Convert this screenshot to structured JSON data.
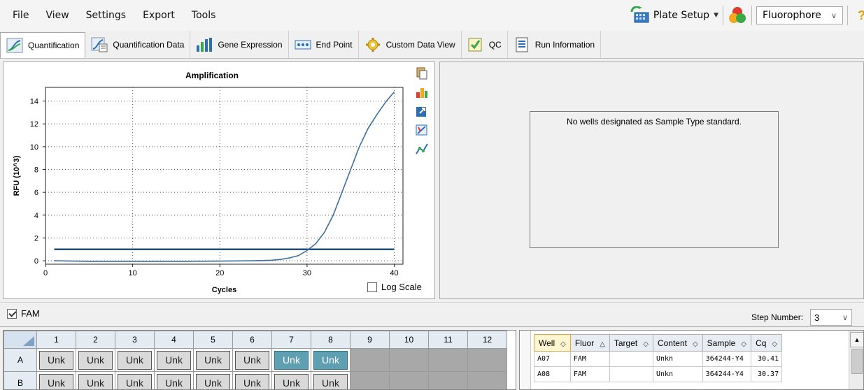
{
  "menu": [
    "File",
    "View",
    "Settings",
    "Export",
    "Tools"
  ],
  "toolbar": {
    "plate_setup_label": "Plate Setup",
    "fluorophore_value": "Fluorophore",
    "help_label": "?"
  },
  "tabs": [
    {
      "label": "Quantification",
      "icon": "amplification-icon",
      "active": true
    },
    {
      "label": "Quantification Data",
      "icon": "quantification-data-icon"
    },
    {
      "label": "Gene Expression",
      "icon": "bar-chart-icon"
    },
    {
      "label": "End Point",
      "icon": "end-point-icon"
    },
    {
      "label": "Custom Data View",
      "icon": "gear-icon"
    },
    {
      "label": "QC",
      "icon": "qc-check-icon"
    },
    {
      "label": "Run Information",
      "icon": "document-icon"
    }
  ],
  "chart_data": {
    "type": "line",
    "title": "Amplification",
    "xlabel": "Cycles",
    "ylabel": "RFU (10^3)",
    "xlim": [
      0,
      41
    ],
    "ylim": [
      -0.3,
      15.2
    ],
    "xticks": [
      0,
      10,
      20,
      30,
      40
    ],
    "yticks": [
      0,
      2,
      4,
      6,
      8,
      10,
      12,
      14
    ],
    "grid": true,
    "threshold": 1.0,
    "series": [
      {
        "color": "#3c6e9e",
        "x": [
          1,
          5,
          10,
          15,
          20,
          24,
          26,
          27,
          28,
          29,
          30,
          31,
          32,
          33,
          34,
          35,
          36,
          37,
          38,
          39,
          40
        ],
        "y": [
          0.0,
          -0.05,
          -0.05,
          -0.05,
          -0.03,
          0.0,
          0.05,
          0.12,
          0.25,
          0.45,
          0.9,
          1.5,
          2.5,
          4.0,
          6.0,
          8.0,
          10.0,
          11.6,
          12.8,
          13.9,
          14.8
        ]
      }
    ],
    "threshold_color": "#1f4e79",
    "log_scale_label": "Log Scale",
    "log_scale_checked": false
  },
  "right_pane": {
    "message": "No wells designated as Sample Type standard."
  },
  "strip": {
    "fluor_label": "FAM",
    "fluor_checked": true,
    "step_label": "Step Number:",
    "step_value": "3"
  },
  "plate": {
    "columns": [
      "1",
      "2",
      "3",
      "4",
      "5",
      "6",
      "7",
      "8",
      "9",
      "10",
      "11",
      "12"
    ],
    "rows": [
      {
        "label": "A",
        "cells": [
          "Unk",
          "Unk",
          "Unk",
          "Unk",
          "Unk",
          "Unk",
          "Unk",
          "Unk",
          "",
          "",
          "",
          ""
        ],
        "selected": [
          6,
          7
        ]
      },
      {
        "label": "B",
        "cells": [
          "Unk",
          "Unk",
          "Unk",
          "Unk",
          "Unk",
          "Unk",
          "Unk",
          "Unk",
          "",
          "",
          "",
          ""
        ],
        "selected": []
      }
    ]
  },
  "results": {
    "headers": [
      "Well",
      "Fluor",
      "Target",
      "Content",
      "Sample",
      "Cq"
    ],
    "sort_glyphs": [
      "◇",
      "△",
      "◇",
      "◇",
      "◇",
      "◇"
    ],
    "rows": [
      [
        "A07",
        "FAM",
        "",
        "Unkn",
        "364244-Y4",
        "30.41"
      ],
      [
        "A08",
        "FAM",
        "",
        "Unkn",
        "364244-Y4",
        "30.37"
      ]
    ]
  },
  "colors": {
    "selected_well": "#5e9fb2",
    "curve": "#3c6e9e",
    "threshold": "#1f4e79",
    "help": "#e0a000"
  }
}
